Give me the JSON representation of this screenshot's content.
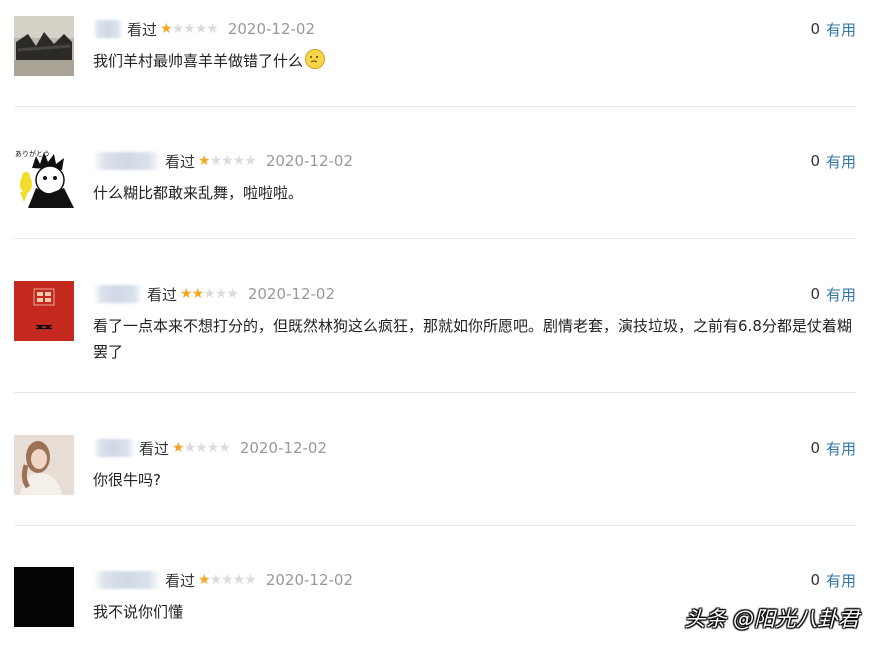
{
  "reviews": [
    {
      "status": "看过",
      "rating": 1,
      "date": "2020-12-02",
      "useful_count": "0",
      "useful_label": "有用",
      "text": "我们羊村最帅喜羊羊做错了什么",
      "emoji": "sad-face-icon"
    },
    {
      "status": "看过",
      "rating": 1,
      "date": "2020-12-02",
      "useful_count": "0",
      "useful_label": "有用",
      "text": "什么糊比都敢来乱舞，啦啦啦。"
    },
    {
      "status": "看过",
      "rating": 2,
      "date": "2020-12-02",
      "useful_count": "0",
      "useful_label": "有用",
      "text": "看了一点本来不想打分的，但既然林狗这么疯狂，那就如你所愿吧。剧情老套，演技垃圾，之前有6.8分都是仗着糊罢了"
    },
    {
      "status": "看过",
      "rating": 1,
      "date": "2020-12-02",
      "useful_count": "0",
      "useful_label": "有用",
      "text": "你很牛吗?"
    },
    {
      "status": "看过",
      "rating": 1,
      "date": "2020-12-02",
      "useful_count": "0",
      "useful_label": "有用",
      "text": "我不说你们懂"
    }
  ],
  "watermark": "头条 @阳光八卦君",
  "colors": {
    "star": "#f6a623",
    "link": "#3377aa",
    "date": "#999999"
  }
}
